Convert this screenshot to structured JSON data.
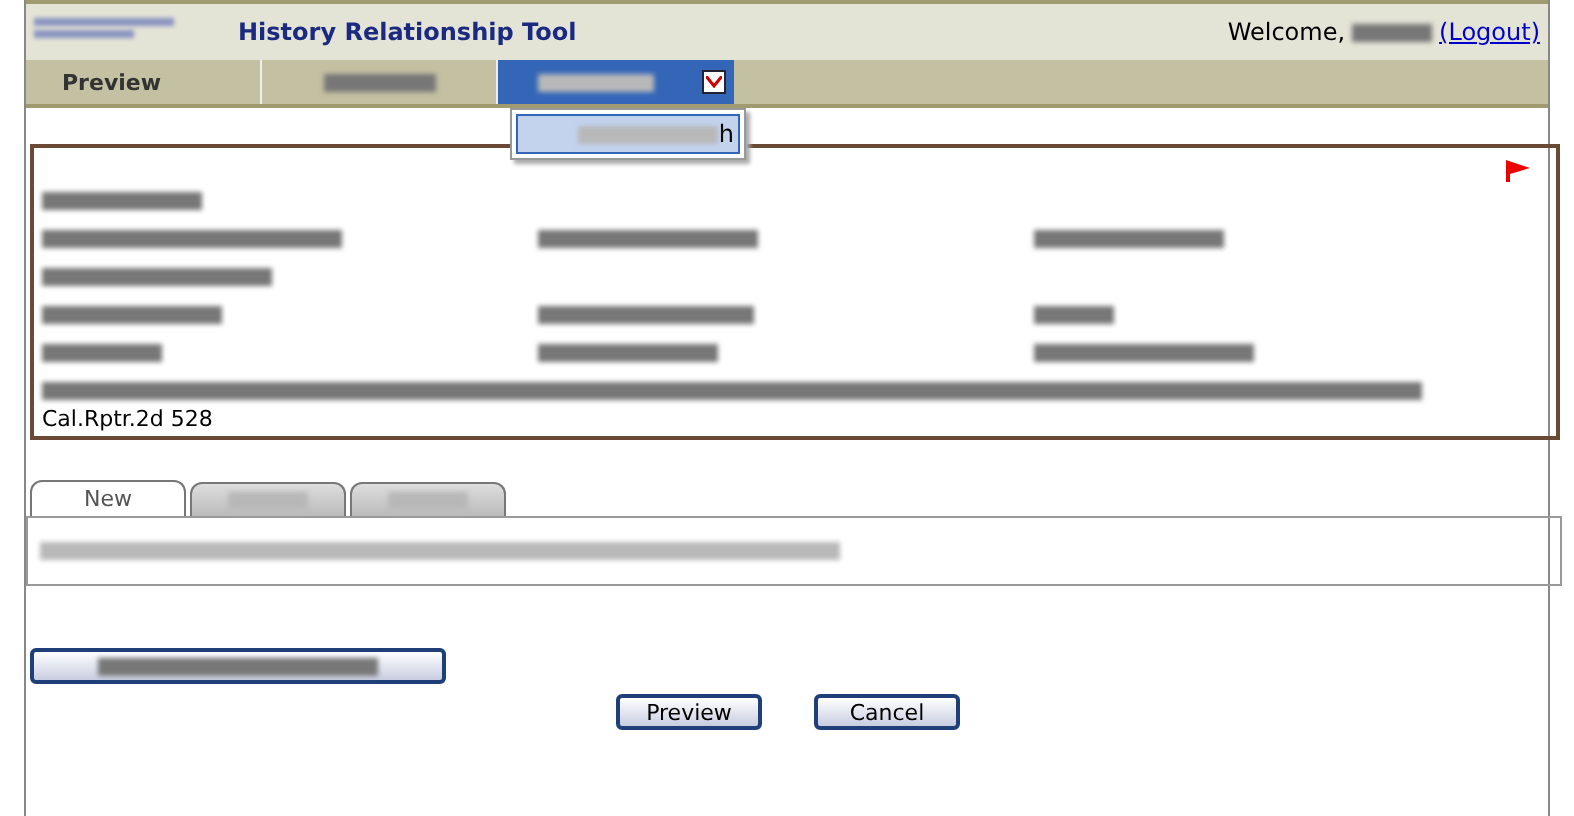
{
  "header": {
    "title": "History Relationship Tool",
    "welcome": "Welcome,",
    "logout": "(Logout)"
  },
  "nav": [
    {
      "kind": "text",
      "label": "Preview",
      "selected": false
    },
    {
      "kind": "blurred",
      "selected": false
    },
    {
      "kind": "dropdown",
      "selected": true
    }
  ],
  "dropdown_menu": {
    "items": [
      {
        "visible_text": "h"
      }
    ]
  },
  "document": {
    "citation_tail": "Cal.Rptr.2d 528"
  },
  "tabs": [
    {
      "label": "New",
      "selected": true
    },
    {
      "selected": false
    },
    {
      "selected": false
    }
  ],
  "buttons": [
    "Preview",
    "Cancel"
  ]
}
